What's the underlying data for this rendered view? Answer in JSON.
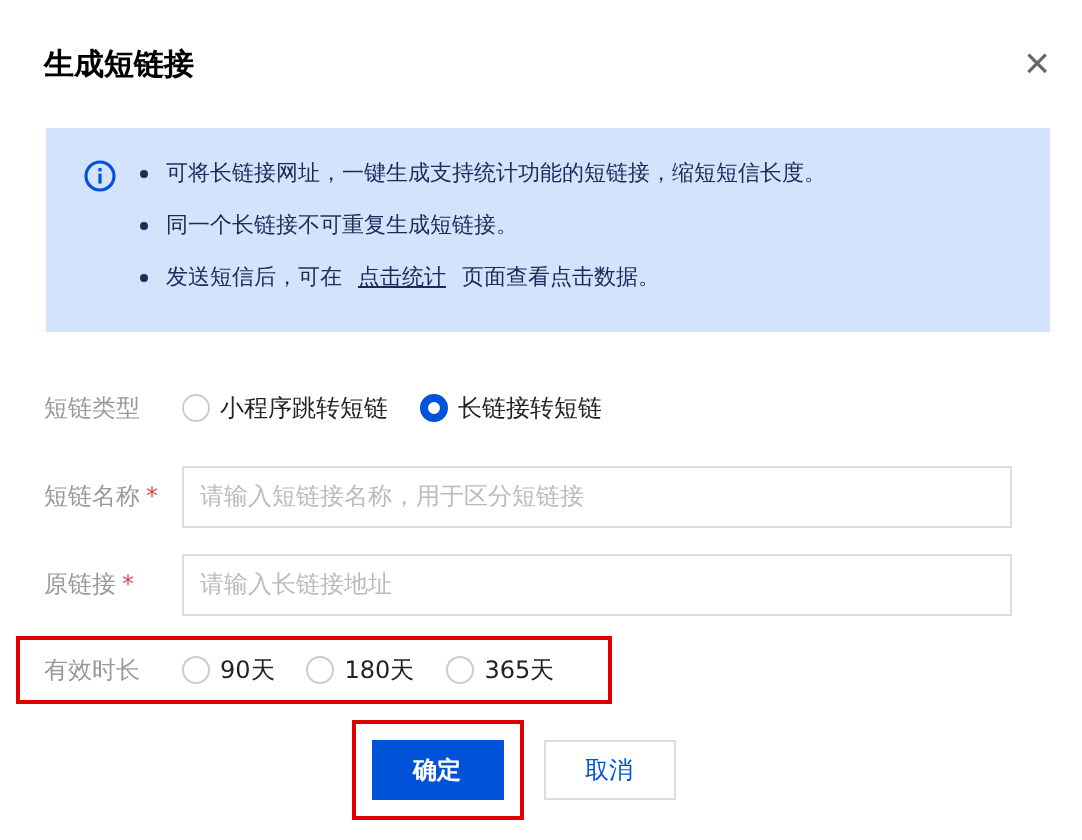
{
  "dialog": {
    "title": "生成短链接",
    "close": "×"
  },
  "notice": {
    "items": [
      {
        "text": "可将长链接网址，一键生成支持统计功能的短链接，缩短短信长度。"
      },
      {
        "text": "同一个长链接不可重复生成短链接。"
      },
      {
        "text": "发送短信后，可在",
        "link": "点击统计",
        "after": "页面查看点击数据。"
      }
    ]
  },
  "form": [
    {
      "kind": "radio",
      "label": "短链类型",
      "highlighted": false,
      "options": [
        {
          "label": "小程序跳转短链",
          "selected": false
        },
        {
          "label": "长链接转短链",
          "selected": true
        }
      ]
    },
    {
      "kind": "input",
      "label": "短链名称",
      "required_mark": "*",
      "highlighted": false,
      "placeholder": "请输入短链接名称，用于区分短链接"
    },
    {
      "kind": "input",
      "label": "原链接",
      "required_mark": "*",
      "highlighted": false,
      "placeholder": "请输入长链接地址"
    },
    {
      "kind": "radio",
      "label": "有效时长",
      "highlighted": true,
      "options": [
        {
          "label": "90天",
          "selected": false
        },
        {
          "label": "180天",
          "selected": false
        },
        {
          "label": "365天",
          "selected": false
        }
      ]
    }
  ],
  "buttons": [
    {
      "label": "确定",
      "kind": "primary",
      "highlighted": true
    },
    {
      "label": "取消",
      "kind": "secondary",
      "highlighted": false
    }
  ]
}
